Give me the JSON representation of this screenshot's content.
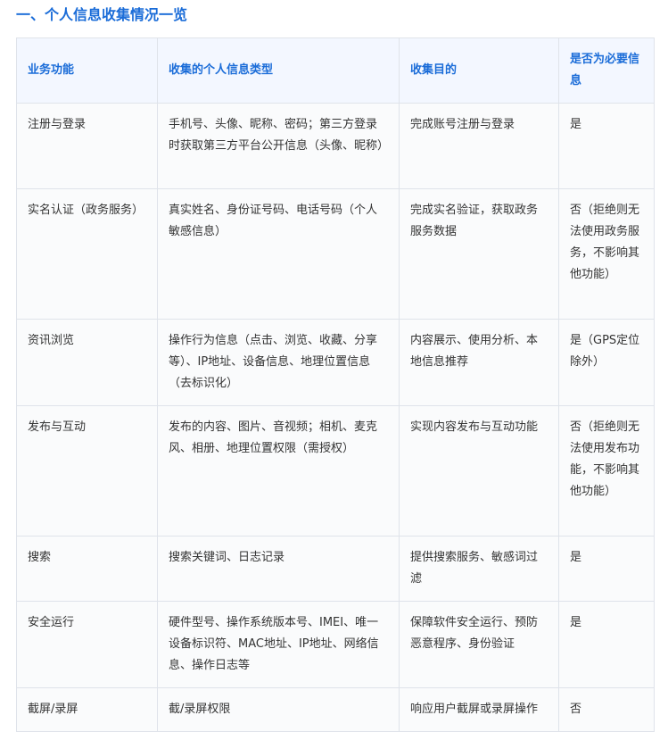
{
  "section": {
    "title": "一、个人信息收集情况一览"
  },
  "table": {
    "headers": {
      "function": "业务功能",
      "info_type": "收集的个人信息类型",
      "purpose": "收集目的",
      "required": "是否为必要信息"
    },
    "rows": [
      {
        "function": "注册与登录",
        "info_type": "手机号、头像、昵称、密码；第三方登录时获取第三方平台公开信息（头像、昵称）",
        "purpose": "完成账号注册与登录",
        "required": "是"
      },
      {
        "function": "实名认证（政务服务）",
        "info_type": "真实姓名、身份证号码、电话号码（个人敏感信息）",
        "purpose": "完成实名验证，获取政务服务数据",
        "required": "否（拒绝则无法使用政务服务，不影响其他功能）"
      },
      {
        "function": "资讯浏览",
        "info_type": "操作行为信息（点击、浏览、收藏、分享等）、IP地址、设备信息、地理位置信息（去标识化）",
        "purpose": "内容展示、使用分析、本地信息推荐",
        "required": "是（GPS定位除外）"
      },
      {
        "function": "发布与互动",
        "info_type": "发布的内容、图片、音视频；相机、麦克风、相册、地理位置权限（需授权）",
        "purpose": "实现内容发布与互动功能",
        "required": "否（拒绝则无法使用发布功能，不影响其他功能）"
      },
      {
        "function": "搜索",
        "info_type": "搜索关键词、日志记录",
        "purpose": "提供搜索服务、敏感词过滤",
        "required": "是"
      },
      {
        "function": "安全运行",
        "info_type": "硬件型号、操作系统版本号、IMEI、唯一设备标识符、MAC地址、IP地址、网络信息、操作日志等",
        "purpose": "保障软件安全运行、预防恶意程序、身份验证",
        "required": "是"
      },
      {
        "function": "截屏/录屏",
        "info_type": "截/录屏权限",
        "purpose": "响应用户截屏或录屏操作",
        "required": "否"
      }
    ]
  }
}
